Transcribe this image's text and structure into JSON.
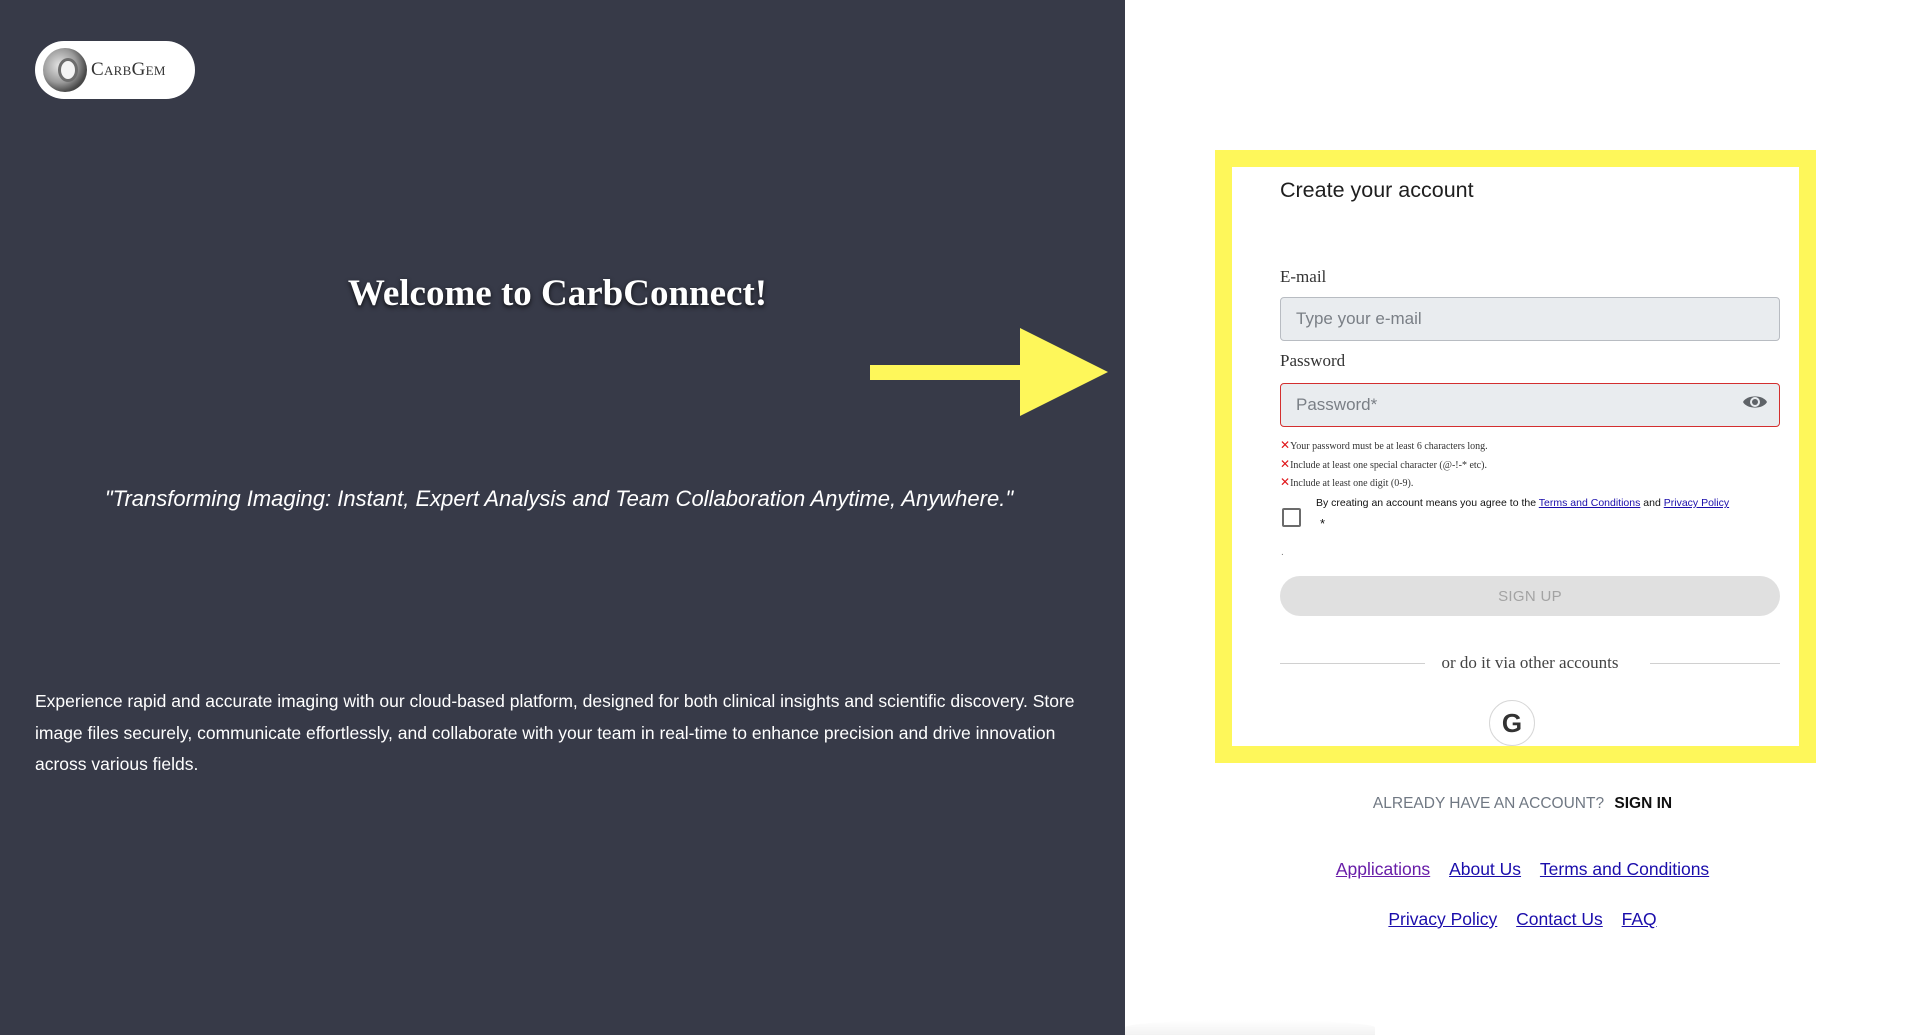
{
  "brand": {
    "logo_text": "CarbGem"
  },
  "left_panel": {
    "welcome": "Welcome to CarbConnect!",
    "tagline": "\"Transforming Imaging: Instant, Expert Analysis and Team Collaboration Anytime, Anywhere.\"",
    "description": "Experience rapid and accurate imaging with our cloud-based platform, designed for both clinical insights and scientific discovery. Store image files securely, communicate effortlessly, and collaborate with your team in real-time to enhance precision and drive innovation across various fields."
  },
  "annotation": {
    "highlight_color": "#fef75a",
    "arrow_color": "#fef75a"
  },
  "form": {
    "title": "Create your account",
    "email_label": "E-mail",
    "email_placeholder": "Type your e-mail",
    "email_value": "",
    "password_label": "Password",
    "password_placeholder": "Password*",
    "password_value": "",
    "password_rules": [
      "Your password must be at least 6 characters long.",
      "Include at least one special character (@-!-* etc).",
      "Include at least one digit (0-9)."
    ],
    "rule_mark": "✕",
    "agree_prefix": "By creating an account means you agree to the",
    "terms_link": "Terms and Conditions",
    "agree_and": "and",
    "privacy_link": "Privacy Policy",
    "required_mark": "*",
    "dot": ".",
    "signup_button": "SIGN UP",
    "or_text": "or do it via other accounts",
    "google_icon": "G"
  },
  "signin": {
    "question": "ALREADY HAVE AN ACCOUNT?",
    "link": "SIGN IN"
  },
  "footer": {
    "row1": [
      "Applications",
      "About Us",
      "Terms and Conditions"
    ],
    "row2": [
      "Privacy Policy",
      "Contact Us",
      "FAQ"
    ]
  },
  "colors": {
    "left_bg": "#373a48",
    "error_border": "#d32f2f",
    "link": "#1a0dab",
    "visited_link": "#681da8"
  }
}
